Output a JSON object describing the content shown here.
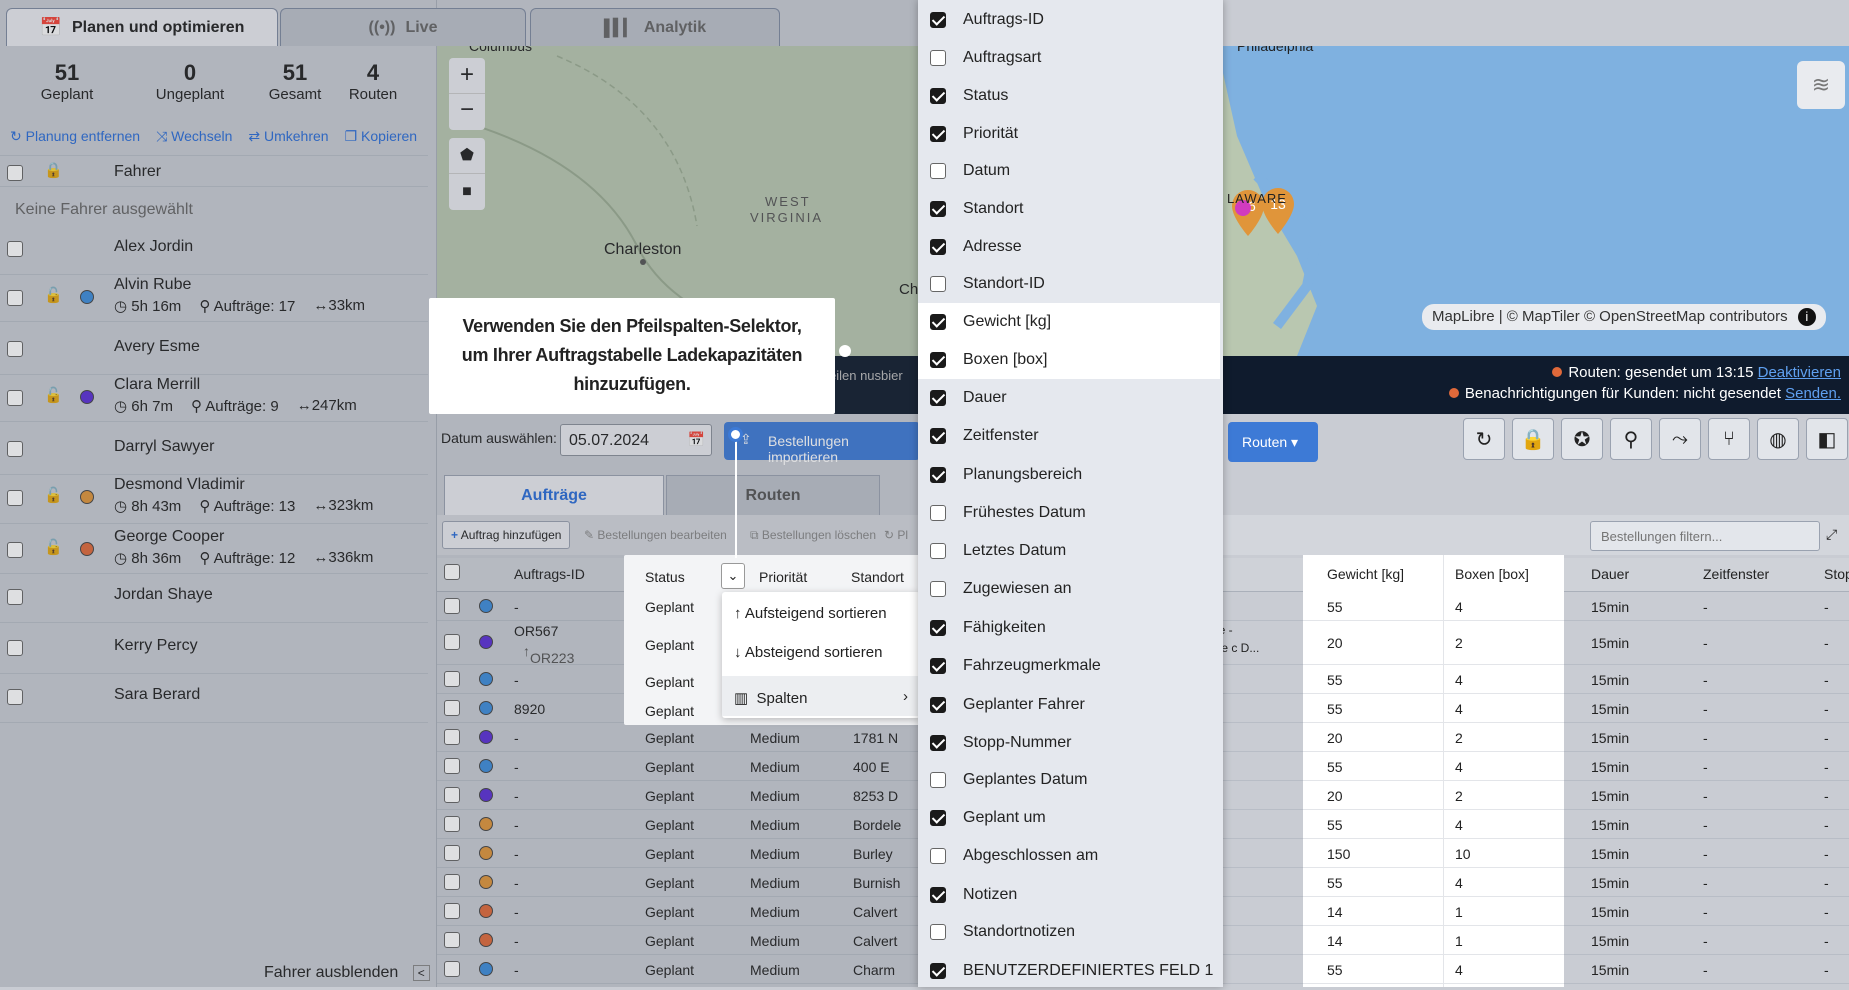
{
  "top_tabs": [
    {
      "label": "Planen und optimieren",
      "icon": "calendar-icon"
    },
    {
      "label": "Live",
      "icon": "broadcast-icon"
    },
    {
      "label": "Analytik",
      "icon": "bar-chart-icon"
    }
  ],
  "stats": [
    {
      "value": "51",
      "label": "Geplant"
    },
    {
      "value": "0",
      "label": "Ungeplant"
    },
    {
      "value": "51",
      "label": "Gesamt"
    },
    {
      "value": "4",
      "label": "Routen"
    }
  ],
  "actions": [
    "Planung entfernen",
    "Wechseln",
    "Umkehren",
    "Kopieren"
  ],
  "driver_header": "Fahrer",
  "no_driver": "Keine Fahrer ausgewählt",
  "drivers": [
    {
      "name": "Alex Jordin"
    },
    {
      "name": "Alvin Rube",
      "time": "5h 16m",
      "orders": "Aufträge: 17",
      "dist": "33km",
      "color": "#3d8ddb"
    },
    {
      "name": "Avery Esme"
    },
    {
      "name": "Clara Merrill",
      "time": "6h 7m",
      "orders": "Aufträge: 9",
      "dist": "247km",
      "color": "#5b2fd6"
    },
    {
      "name": "Darryl Sawyer"
    },
    {
      "name": "Desmond Vladimir",
      "time": "8h 43m",
      "orders": "Aufträge: 13",
      "dist": "323km",
      "color": "#e0953a"
    },
    {
      "name": "George Cooper",
      "time": "8h 36m",
      "orders": "Aufträge: 12",
      "dist": "336km",
      "color": "#e0693a"
    },
    {
      "name": "Jordan Shaye"
    },
    {
      "name": "Kerry Percy"
    },
    {
      "name": "Sara Berard"
    }
  ],
  "hide_drivers": "Fahrer ausblenden",
  "map": {
    "labels": [
      "Columbus",
      "WEST",
      "VIRGINIA",
      "Charleston",
      "Ch",
      "Philadelphia",
      "LAWARE"
    ],
    "pins": [
      "16",
      "13"
    ],
    "attribution": "MapLibre | © MapTiler © OpenStreetMap contributors"
  },
  "callout": "Verwenden Sie den Pfeilspalten-Selektor, um Ihrer Auftragstabelle Ladekapazitäten hinzuzufügen.",
  "status_bar": {
    "routes": "Routen: gesendet um 13:15",
    "deactivate": "Deaktivieren",
    "notify": "Benachrichtigungen für Kunden: nicht gesendet",
    "send": "Senden.",
    "partial": "eilen nusbier"
  },
  "date_label": "Datum auswählen:",
  "date_value": "05.07.2024",
  "import_btn": "Bestellungen importieren",
  "routes_btn": "Routen",
  "sub_tabs": [
    "Aufträge",
    "Routen"
  ],
  "order_actions": [
    "Auftrag hinzufügen",
    "Bestellungen bearbeiten",
    "Bestellungen löschen",
    "Pl"
  ],
  "filter_placeholder": "Bestellungen filtern...",
  "table_headers": [
    "Auftrags-ID",
    "Status",
    "Priorität",
    "Standort",
    "Gewicht [kg]",
    "Boxen [box]",
    "Dauer",
    "Zeitfenster",
    "Stop"
  ],
  "rows": [
    {
      "color": "#3d8ddb",
      "id": "-",
      "status": "Geplant",
      "prio": "",
      "loc": "",
      "w": "55",
      "b": "4",
      "d": "15min",
      "z": "-",
      "s": "-"
    },
    {
      "color": "#5b2fd6",
      "id": "OR567",
      "sub": "OR223",
      "status": "Geplant",
      "prio": "",
      "loc": "",
      "w": "20",
      "b": "2",
      "d": "15min",
      "z": "-",
      "s": "-",
      "extra1": "ee -",
      "extra2": "ale c D..."
    },
    {
      "color": "#3d8ddb",
      "id": "-",
      "status": "Geplant",
      "prio": "",
      "loc": "",
      "w": "55",
      "b": "4",
      "d": "15min",
      "z": "-",
      "s": "-"
    },
    {
      "color": "#3d8ddb",
      "id": "8920",
      "status": "Geplant",
      "prio": "",
      "loc": "",
      "w": "55",
      "b": "4",
      "d": "15min",
      "z": "-",
      "s": "-"
    },
    {
      "color": "#5b2fd6",
      "id": "-",
      "status": "Geplant",
      "prio": "Medium",
      "loc": "1781 N",
      "w": "20",
      "b": "2",
      "d": "15min",
      "z": "-",
      "s": "-"
    },
    {
      "color": "#3d8ddb",
      "id": "-",
      "status": "Geplant",
      "prio": "Medium",
      "loc": "400 E",
      "w": "55",
      "b": "4",
      "d": "15min",
      "z": "-",
      "s": "-"
    },
    {
      "color": "#5b2fd6",
      "id": "-",
      "status": "Geplant",
      "prio": "Medium",
      "loc": "8253 D",
      "w": "20",
      "b": "2",
      "d": "15min",
      "z": "-",
      "s": "-"
    },
    {
      "color": "#e0953a",
      "id": "-",
      "status": "Geplant",
      "prio": "Medium",
      "loc": "Bordele",
      "w": "55",
      "b": "4",
      "d": "15min",
      "z": "-",
      "s": "-"
    },
    {
      "color": "#e0953a",
      "id": "-",
      "status": "Geplant",
      "prio": "Medium",
      "loc": "Burley",
      "w": "150",
      "b": "10",
      "d": "15min",
      "z": "-",
      "s": "-"
    },
    {
      "color": "#e0953a",
      "id": "-",
      "status": "Geplant",
      "prio": "Medium",
      "loc": "Burnish",
      "w": "55",
      "b": "4",
      "d": "15min",
      "z": "-",
      "s": "-"
    },
    {
      "color": "#e0693a",
      "id": "-",
      "status": "Geplant",
      "prio": "Medium",
      "loc": "Calvert",
      "w": "14",
      "b": "1",
      "d": "15min",
      "z": "-",
      "s": "-"
    },
    {
      "color": "#e0693a",
      "id": "-",
      "status": "Geplant",
      "prio": "Medium",
      "loc": "Calvert",
      "w": "14",
      "b": "1",
      "d": "15min",
      "z": "-",
      "s": "-"
    },
    {
      "color": "#3d8ddb",
      "id": "-",
      "status": "Geplant",
      "prio": "Medium",
      "loc": "Charm",
      "w": "55",
      "b": "4",
      "d": "15min",
      "z": "-",
      "s": "-"
    }
  ],
  "sort_menu": [
    "Aufsteigend sortieren",
    "Absteigend sortieren",
    "Spalten"
  ],
  "columns": [
    {
      "label": "Auftrags-ID",
      "checked": true
    },
    {
      "label": "Auftragsart",
      "checked": false
    },
    {
      "label": "Status",
      "checked": true
    },
    {
      "label": "Priorität",
      "checked": true
    },
    {
      "label": "Datum",
      "checked": false
    },
    {
      "label": "Standort",
      "checked": true
    },
    {
      "label": "Adresse",
      "checked": true
    },
    {
      "label": "Standort-ID",
      "checked": false
    },
    {
      "label": "Gewicht [kg]",
      "checked": true,
      "hl": true
    },
    {
      "label": "Boxen [box]",
      "checked": true,
      "hl": true
    },
    {
      "label": "Dauer",
      "checked": true
    },
    {
      "label": "Zeitfenster",
      "checked": true
    },
    {
      "label": "Planungsbereich",
      "checked": true
    },
    {
      "label": "Frühestes Datum",
      "checked": false
    },
    {
      "label": "Letztes Datum",
      "checked": false
    },
    {
      "label": "Zugewiesen an",
      "checked": false
    },
    {
      "label": "Fähigkeiten",
      "checked": true
    },
    {
      "label": "Fahrzeugmerkmale",
      "checked": true
    },
    {
      "label": "Geplanter Fahrer",
      "checked": true
    },
    {
      "label": "Stopp-Nummer",
      "checked": true
    },
    {
      "label": "Geplantes Datum",
      "checked": false
    },
    {
      "label": "Geplant um",
      "checked": true
    },
    {
      "label": "Abgeschlossen am",
      "checked": false
    },
    {
      "label": "Notizen",
      "checked": true
    },
    {
      "label": "Standortnotizen",
      "checked": false
    },
    {
      "label": "BENUTZERDEFINIERTES FELD 1",
      "checked": true
    }
  ],
  "colors": {
    "accent": "#2a6dd8",
    "dark_bar": "#0f1b2d",
    "ocean": "#7fb1e0",
    "land": "#b9c7b0"
  }
}
